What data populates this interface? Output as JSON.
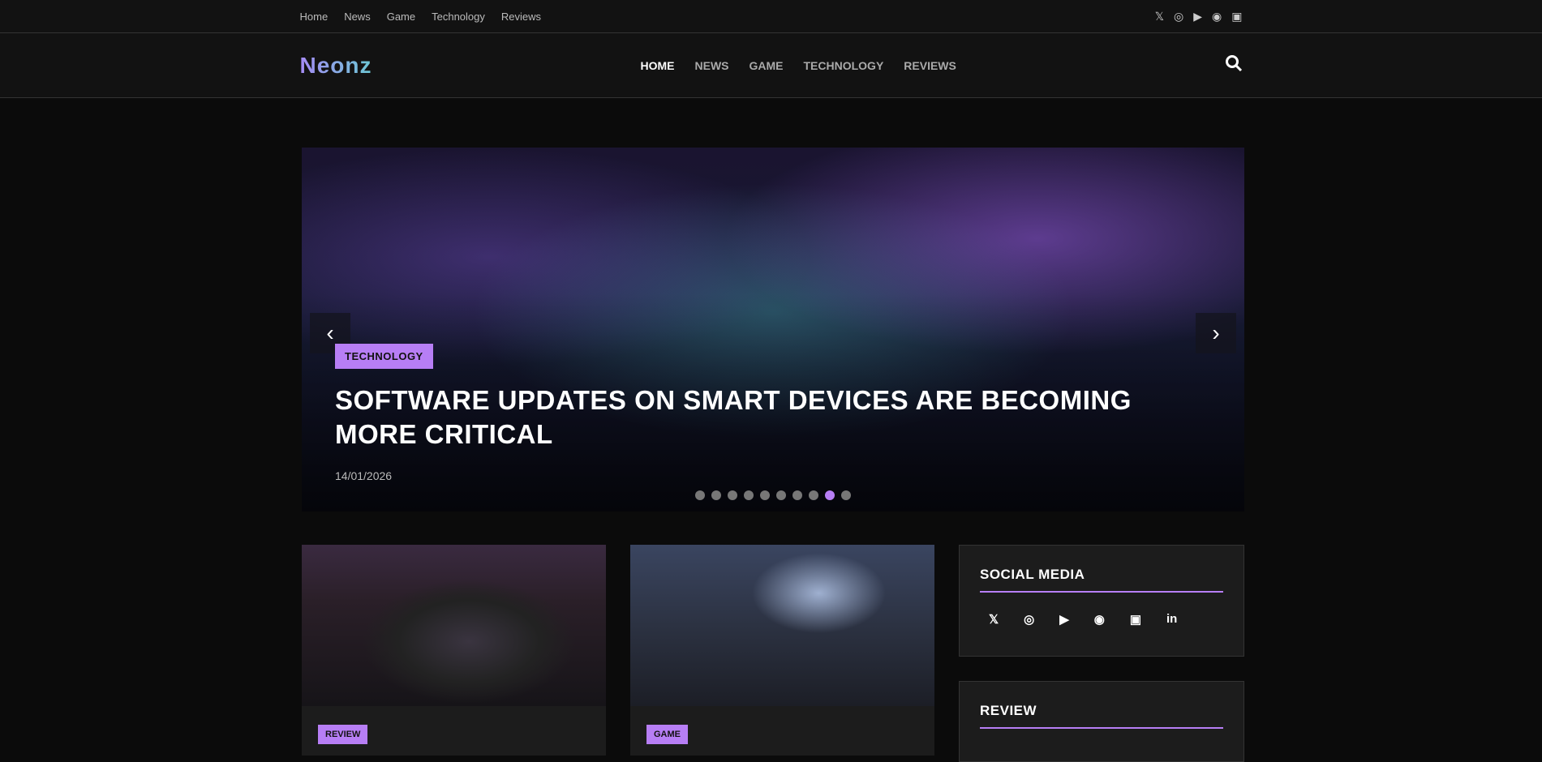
{
  "topbar": {
    "links": [
      "Home",
      "News",
      "Game",
      "Technology",
      "Reviews"
    ],
    "social": [
      "𝕏",
      "◎",
      "▶",
      "◉",
      "▣"
    ]
  },
  "header": {
    "logo": "Neonz",
    "nav": [
      "HOME",
      "NEWS",
      "GAME",
      "TECHNOLOGY",
      "REVIEWS"
    ],
    "search_icon": "⚲"
  },
  "slider": {
    "category": "TECHNOLOGY",
    "title": "SOFTWARE UPDATES ON SMART DEVICES ARE BECOMING MORE CRITICAL",
    "date": "14/01/2026",
    "prev": "‹",
    "next": "›",
    "slide_count": 10,
    "active_slide": 9
  },
  "cards": [
    {
      "category": "REVIEW"
    },
    {
      "category": "GAME"
    }
  ],
  "sidebar": {
    "social_title": "SOCIAL MEDIA",
    "social": [
      "𝕏",
      "◎",
      "▶",
      "◉",
      "▣",
      "in"
    ],
    "review_title": "REVIEW"
  },
  "colors": {
    "accent": "#b77ef5"
  }
}
